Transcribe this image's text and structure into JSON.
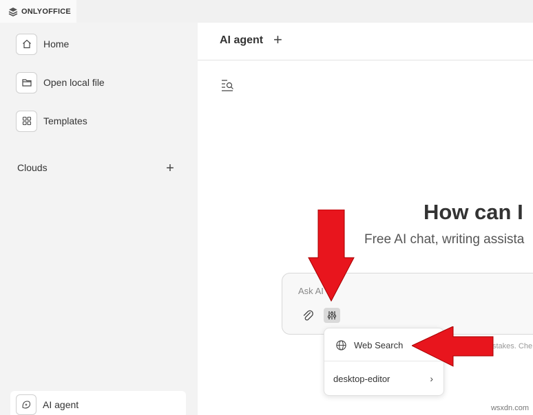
{
  "app": {
    "brand": "ONLYOFFICE"
  },
  "sidebar": {
    "items": [
      {
        "label": "Home",
        "icon": "home-icon"
      },
      {
        "label": "Open local file",
        "icon": "folder-icon"
      },
      {
        "label": "Templates",
        "icon": "grid-icon"
      }
    ],
    "clouds_label": "Clouds",
    "clouds_add": "+",
    "active_item": {
      "label": "AI agent",
      "icon": "ai-sparkle-icon"
    }
  },
  "main": {
    "title": "AI agent",
    "add": "+",
    "hero_title": "How can I",
    "hero_subtitle": "Free AI chat, writing assista",
    "input_placeholder": "Ask AI",
    "disclaimer": "stakes. Che"
  },
  "dropdown": {
    "items": [
      {
        "label": "Web Search",
        "icon": "globe-icon"
      },
      {
        "label": "desktop-editor",
        "chevron": "›"
      }
    ]
  },
  "annotations": {
    "arrow_color": "#e8151d"
  },
  "watermark": "wsxdn.com"
}
